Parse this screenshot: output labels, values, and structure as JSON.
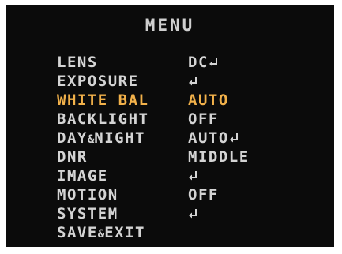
{
  "menu": {
    "title": "MENU",
    "items": [
      {
        "label_pre": "LENS",
        "amp": "",
        "label_post": "",
        "value": "DC",
        "enter": true,
        "selected": false
      },
      {
        "label_pre": "EXPOSURE",
        "amp": "",
        "label_post": "",
        "value": "",
        "enter": true,
        "selected": false
      },
      {
        "label_pre": "WHITE BAL",
        "amp": "",
        "label_post": "",
        "value": "AUTO",
        "enter": false,
        "selected": true
      },
      {
        "label_pre": "BACKLIGHT",
        "amp": "",
        "label_post": "",
        "value": "OFF",
        "enter": false,
        "selected": false
      },
      {
        "label_pre": "DAY",
        "amp": "&",
        "label_post": "NIGHT",
        "value": "AUTO",
        "enter": true,
        "selected": false
      },
      {
        "label_pre": "DNR",
        "amp": "",
        "label_post": "",
        "value": "MIDDLE",
        "enter": false,
        "selected": false
      },
      {
        "label_pre": "IMAGE",
        "amp": "",
        "label_post": "",
        "value": "",
        "enter": true,
        "selected": false
      },
      {
        "label_pre": "MOTION",
        "amp": "",
        "label_post": "",
        "value": "OFF",
        "enter": false,
        "selected": false
      },
      {
        "label_pre": "SYSTEM",
        "amp": "",
        "label_post": "",
        "value": "",
        "enter": true,
        "selected": false
      },
      {
        "label_pre": "SAVE",
        "amp": "&",
        "label_post": "EXIT",
        "value": "",
        "enter": false,
        "selected": false
      }
    ]
  },
  "colors": {
    "background": "#0b0b0b",
    "text": "#d4d4d4",
    "highlight": "#f2b14a"
  },
  "icons": {
    "enter": "enter-return-icon"
  }
}
